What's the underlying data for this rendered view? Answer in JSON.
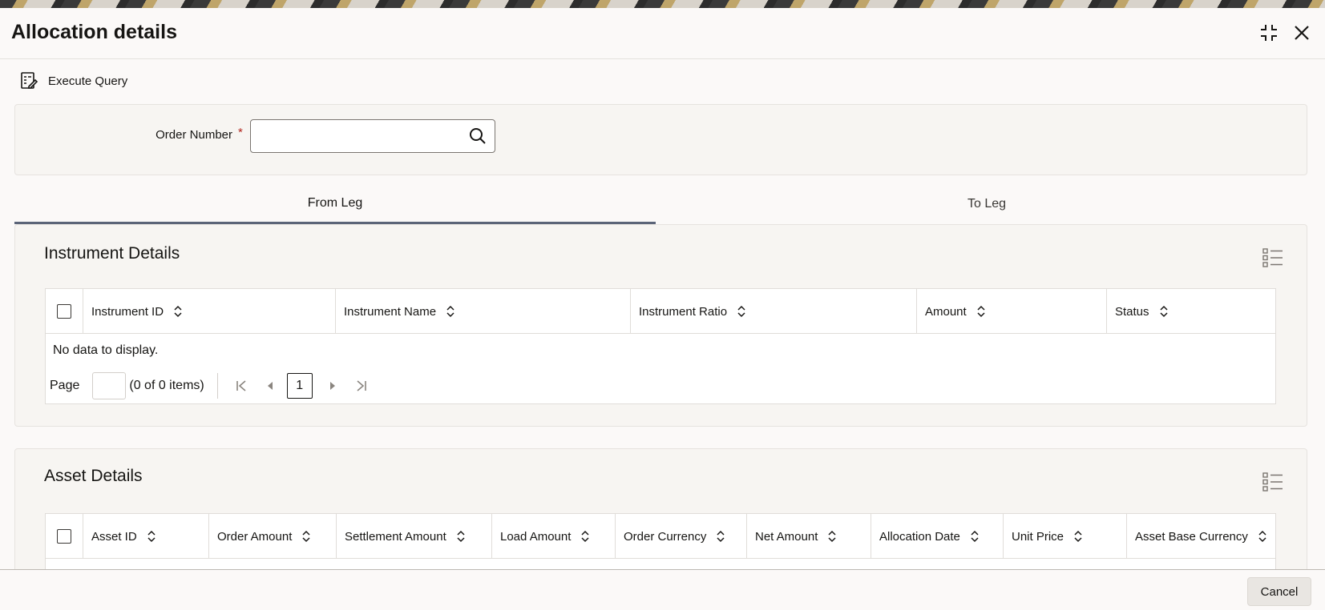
{
  "dialog": {
    "title": "Allocation details"
  },
  "toolbar": {
    "execute_query_label": "Execute Query"
  },
  "form": {
    "order_number_label": "Order Number",
    "required_mark": "*",
    "order_number_value": "",
    "order_number_placeholder": ""
  },
  "tabs": [
    {
      "label": "From Leg",
      "active": true
    },
    {
      "label": "To Leg",
      "active": false
    }
  ],
  "instrument_details": {
    "title": "Instrument Details",
    "columns": [
      "Instrument ID",
      "Instrument Name",
      "Instrument Ratio",
      "Amount",
      "Status"
    ],
    "empty_text": "No data to display.",
    "pager": {
      "page_label": "Page",
      "page_value": "",
      "items_text": "(0 of 0 items)",
      "current_page": "1"
    }
  },
  "asset_details": {
    "title": "Asset Details",
    "columns": [
      "Asset ID",
      "Order Amount",
      "Settlement Amount",
      "Load Amount",
      "Order Currency",
      "Net Amount",
      "Allocation Date",
      "Unit Price",
      "Asset Base Currency"
    ]
  },
  "footer": {
    "cancel_label": "Cancel"
  },
  "icons": {
    "execute_query": "execute-query-icon",
    "maximize": "collapse-icon",
    "close": "close-icon",
    "search": "search-icon",
    "list_view": "list-view-icon",
    "sort": "sort-icon"
  },
  "colors": {
    "active_tab_underline": "#5b6478",
    "required": "#b3261e"
  }
}
